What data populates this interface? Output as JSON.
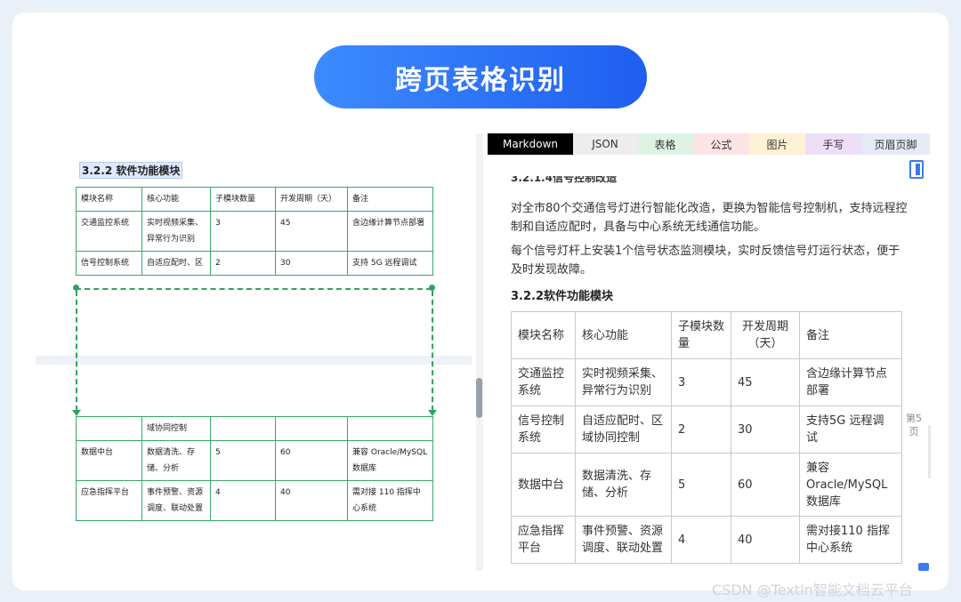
{
  "banner": {
    "title": "跨页表格识别"
  },
  "source_doc": {
    "heading": "3.2.2 软件功能模块",
    "top_table": [
      [
        "模块名称",
        "核心功能",
        "子模块数量",
        "开发周期（天）",
        "备注"
      ],
      [
        "交通监控系统",
        "实时视频采集、异常行为识别",
        "3",
        "45",
        "含边缘计算节点部署"
      ],
      [
        "信号控制系统",
        "自适应配时、区",
        "2",
        "30",
        "支持 5G 远程调试"
      ]
    ],
    "bottom_table": [
      [
        "",
        "域协同控制",
        "",
        "",
        ""
      ],
      [
        "数据中台",
        "数据清洗、存储、分析",
        "5",
        "60",
        "兼容 Oracle/MySQL 数据库"
      ],
      [
        "应急指挥平台",
        "事件预警、资源调度、联动处置",
        "4",
        "40",
        "需对接 110 指挥中心系统"
      ]
    ]
  },
  "result": {
    "tabs": [
      "Markdown",
      "JSON",
      "表格",
      "公式",
      "图片",
      "手写",
      "页眉页脚"
    ],
    "cut_heading": "3.2.1.4信号控制改造",
    "paragraphs": [
      "对全市80个交通信号灯进行智能化改造，更换为智能信号控制机，支持远程控制和自适应配时，具备与中心系统无线通信功能。",
      "每个信号灯杆上安装1个信号状态监测模块，实时反馈信号灯运行状态，便于及时发现故障。"
    ],
    "table_heading": "3.2.2软件功能模块",
    "table": [
      [
        "模块名称",
        "核心功能",
        "子模块数量",
        "开发周期（天）",
        "备注"
      ],
      [
        "交通监控系统",
        "实时视频采集、异常行为识别",
        "3",
        "45",
        "含边缘计算节点部署"
      ],
      [
        "信号控制系统",
        "自适应配时、区域协同控制",
        "2",
        "30",
        "支持5G 远程调试"
      ],
      [
        "数据中台",
        "数据清洗、存储、分析",
        "5",
        "60",
        "兼容Oracle/MySQL数据库"
      ],
      [
        "应急指挥平台",
        "事件预警、资源调度、联动处置",
        "4",
        "40",
        "需对接110 指挥中心系统"
      ]
    ],
    "page_indicator": "第5页"
  },
  "watermark": "CSDN @TextIn智能文档云平台"
}
